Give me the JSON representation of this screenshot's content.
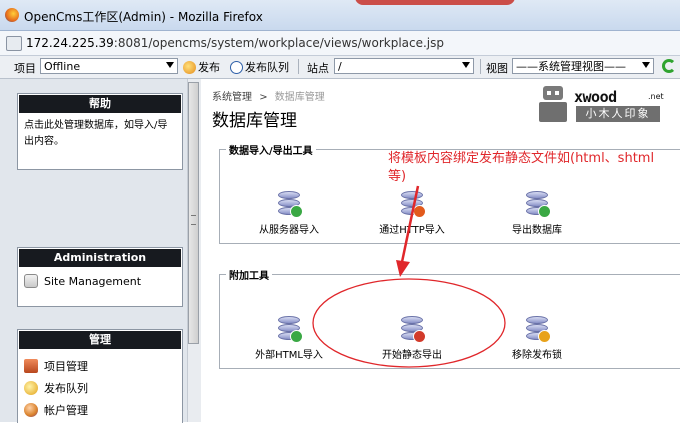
{
  "window": {
    "title": "OpenCms工作区(Admin) - Mozilla Firefox",
    "url_host": "172.24.225.39",
    "url_rest": ":8081/opencms/system/workplace/views/workplace.jsp"
  },
  "toolbar": {
    "project_label": "项目",
    "project_value": "Offline",
    "publish_label": "发布",
    "publish_queue_label": "发布队列",
    "site_label": "站点",
    "site_value": "/",
    "view_label": "视图",
    "view_value": "——系统管理视图——"
  },
  "sidebar": {
    "help": {
      "title": "帮助",
      "text": "点击此处管理数据库，如导入/导出内容。"
    },
    "administration": {
      "title": "Administration",
      "items": [
        {
          "label": "Site Management",
          "icon": "site-management-icon"
        }
      ]
    },
    "manage": {
      "title": "管理",
      "items": [
        {
          "label": "项目管理",
          "icon": "project-icon"
        },
        {
          "label": "发布队列",
          "icon": "publish-queue-icon"
        },
        {
          "label": "帐户管理",
          "icon": "account-icon"
        }
      ]
    }
  },
  "main": {
    "breadcrumb": {
      "root": "系统管理",
      "separator": ">",
      "current": "数据库管理"
    },
    "title": "数据库管理",
    "logo": {
      "word": "xwood",
      "tld": ".net",
      "sub": "小木人印象"
    },
    "groups": [
      {
        "legend": "数据导入/导出工具",
        "tools": [
          {
            "label": "从服务器导入",
            "badge_color": "#3aa844"
          },
          {
            "label": "通过HTTP导入",
            "badge_color": "#e25a1c"
          },
          {
            "label": "导出数据库",
            "badge_color": "#3aa844"
          }
        ]
      },
      {
        "legend": "附加工具",
        "tools": [
          {
            "label": "外部HTML导入",
            "badge_color": "#3aa844"
          },
          {
            "label": "开始静态导出",
            "badge_color": "#d23a2a"
          },
          {
            "label": "移除发布锁",
            "badge_color": "#e8a21a"
          }
        ]
      }
    ],
    "annotation": "将模板内容绑定发布静态文件如(html、shtml等)"
  },
  "colors": {
    "annotation_red": "#e0272b",
    "sidebar_header": "#171a1f",
    "sidebar_bg": "#e1e6ec"
  }
}
